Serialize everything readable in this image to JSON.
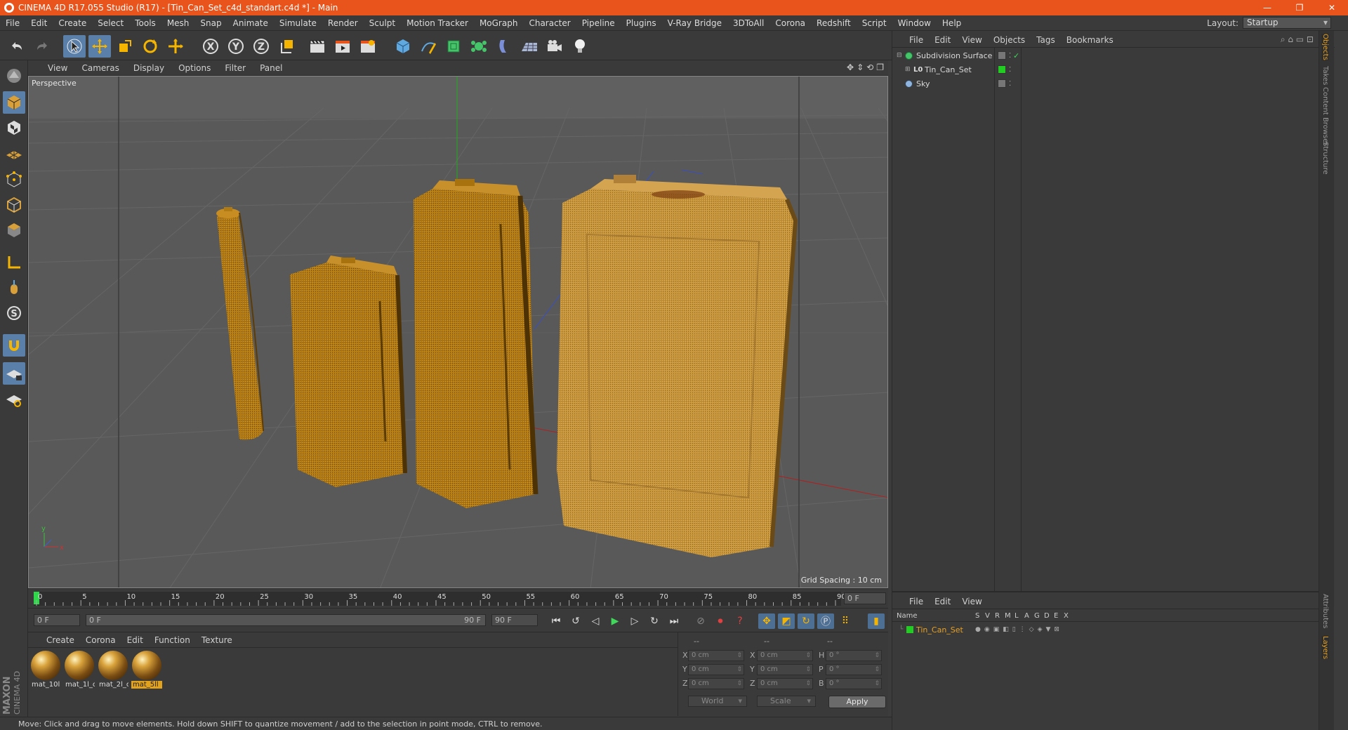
{
  "window": {
    "title": "CINEMA 4D R17.055 Studio (R17) - [Tin_Can_Set_c4d_standart.c4d *] - Main",
    "controls": [
      "—",
      "❐",
      "✕"
    ]
  },
  "menubar": [
    "File",
    "Edit",
    "Create",
    "Select",
    "Tools",
    "Mesh",
    "Snap",
    "Animate",
    "Simulate",
    "Render",
    "Sculpt",
    "Motion Tracker",
    "MoGraph",
    "Character",
    "Pipeline",
    "Plugins",
    "V-Ray Bridge",
    "3DToAll",
    "Corona",
    "Redshift",
    "Script",
    "Window",
    "Help"
  ],
  "layout": {
    "label": "Layout:",
    "value": "Startup"
  },
  "viewport": {
    "menu": [
      "View",
      "Cameras",
      "Display",
      "Options",
      "Filter",
      "Panel"
    ],
    "label": "Perspective",
    "grid_spacing": "Grid Spacing : 10 cm",
    "axis": {
      "y": "y",
      "x": "x"
    }
  },
  "timeline": {
    "ticks": [
      "0",
      "5",
      "10",
      "15",
      "20",
      "25",
      "30",
      "35",
      "40",
      "45",
      "50",
      "55",
      "60",
      "65",
      "70",
      "75",
      "80",
      "85",
      "90"
    ],
    "end_field": "0 F"
  },
  "timecontrols": {
    "start": "0 F",
    "range_start": "0 F",
    "range_end": "90 F",
    "end": "90 F"
  },
  "materials": {
    "menu": [
      "Create",
      "Corona",
      "Edit",
      "Function",
      "Texture"
    ],
    "items": [
      {
        "label": "mat_10l",
        "selected": false
      },
      {
        "label": "mat_1l_c",
        "selected": false
      },
      {
        "label": "mat_2l_c",
        "selected": false
      },
      {
        "label": "mat_5ll",
        "selected": true
      }
    ]
  },
  "coordinates": {
    "headers": [
      "--",
      "--",
      "--"
    ],
    "rows": [
      {
        "a": "X",
        "av": "0 cm",
        "b": "X",
        "bv": "0 cm",
        "c": "H",
        "cv": "0 °"
      },
      {
        "a": "Y",
        "av": "0 cm",
        "b": "Y",
        "bv": "0 cm",
        "c": "P",
        "cv": "0 °"
      },
      {
        "a": "Z",
        "av": "0 cm",
        "b": "Z",
        "bv": "0 cm",
        "c": "B",
        "cv": "0 °"
      }
    ],
    "mode1": "World",
    "mode2": "Scale",
    "apply": "Apply"
  },
  "status": "Move: Click and drag to move elements. Hold down SHIFT to quantize movement / add to the selection in point mode, CTRL to remove.",
  "objects": {
    "menu": [
      "File",
      "Edit",
      "View",
      "Objects",
      "Tags",
      "Bookmarks"
    ],
    "items": [
      {
        "name": "Subdivision Surface",
        "indent": 0
      },
      {
        "name": "Tin_Can_Set",
        "indent": 1
      },
      {
        "name": "Sky",
        "indent": 0
      }
    ]
  },
  "layers": {
    "menu": [
      "File",
      "Edit",
      "View"
    ],
    "columns": [
      "Name",
      "S",
      "V",
      "R",
      "M",
      "L",
      "A",
      "G",
      "D",
      "E",
      "X"
    ],
    "items": [
      {
        "name": "Tin_Can_Set"
      }
    ]
  },
  "side_tabs": [
    "Objects",
    "Takes",
    "Content Browser",
    "Structure",
    "Attributes",
    "Layers"
  ],
  "brand": {
    "line1": "MAXON",
    "line2": "CINEMA 4D"
  },
  "colors": {
    "accent": "#e9541c",
    "selection": "#5a7fa8",
    "can": "#b0780f",
    "layer_green": "#22cc22"
  }
}
